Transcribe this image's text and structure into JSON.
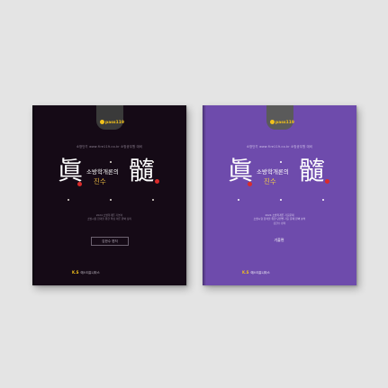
{
  "books": [
    {
      "theme": "dark",
      "cover_color": "#150a16",
      "tab_logo": "pass119",
      "top_line": "소방단기 www.fire119.co.kr 소방공무원 대비",
      "title_han_left": "眞",
      "title_han_right": "髓",
      "subtitle": "소방학개론의",
      "title_main": "진수",
      "small_lines": [
        "2024 소방학개론 기본서",
        "소방시험 합격을 위한 핵심 이론 완벽 정리"
      ],
      "author": "김한수 편저",
      "publisher": "에스티유니타스",
      "publisher_mark": "K.S"
    },
    {
      "theme": "purple",
      "cover_color": "#6e4bac",
      "tab_logo": "pass119",
      "top_line": "소방단기 www.fire119.co.kr 소방공무원 대비",
      "title_han_left": "眞",
      "title_han_right": "髓",
      "subtitle": "소방학개론의",
      "title_main": "진수",
      "small_lines": [
        "2024 소방학개론 기출문제",
        "소방시험 합격을 위한 단원별 기출 문제 완벽 분석"
      ],
      "author": "기출편",
      "extra_line": "김한수 편저",
      "publisher": "에스티유니타스",
      "publisher_mark": "K.S"
    }
  ],
  "colors": {
    "background": "#e4e4e4",
    "accent_gold": "#e3b33f",
    "accent_red": "#d92b2b"
  }
}
